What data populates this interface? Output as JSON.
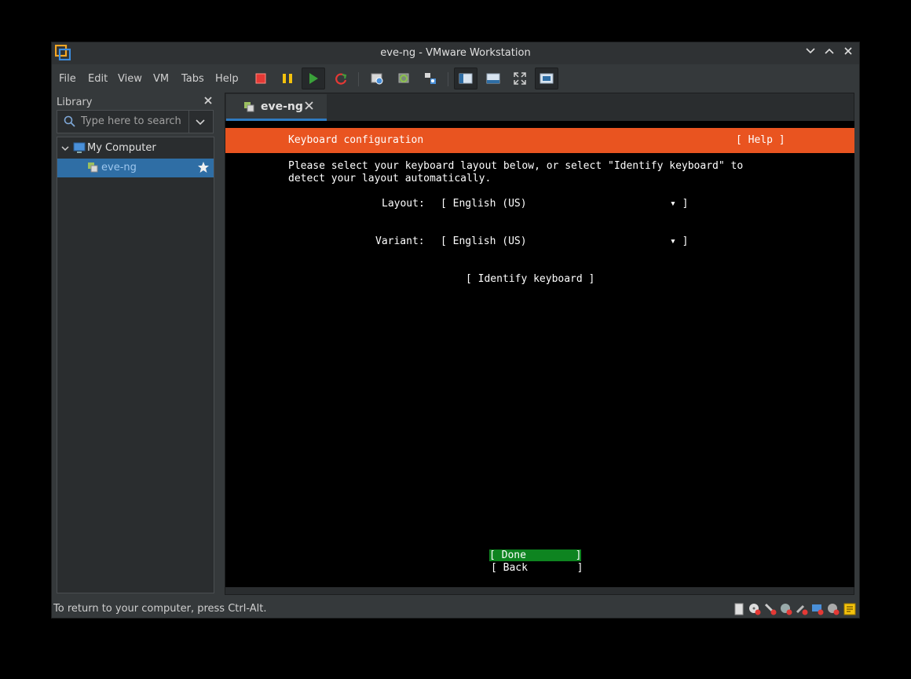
{
  "window": {
    "title": "eve-ng - VMware Workstation"
  },
  "menu": {
    "file": "File",
    "edit": "Edit",
    "view": "View",
    "vm": "VM",
    "tabs": "Tabs",
    "help": "Help"
  },
  "library": {
    "title": "Library",
    "search_placeholder": "Type here to search",
    "tree": [
      {
        "label": "My Computer"
      },
      {
        "label": "eve-ng"
      }
    ]
  },
  "tab": {
    "label": "eve-ng"
  },
  "console": {
    "header_title": "Keyboard configuration",
    "help_label": "[ Help ]",
    "instructions_line1": "Please select your keyboard layout below, or select \"Identify keyboard\" to",
    "instructions_line2": "detect your layout automatically.",
    "layout_label": "Layout:",
    "layout_value": "[ English (US)",
    "layout_end": "▾ ]",
    "variant_label": "Variant:",
    "variant_value": "[ English (US)",
    "variant_end": "▾ ]",
    "identify_label": "[ Identify keyboard ]",
    "done_label": "[ Done        ]",
    "back_label": "[ Back        ]"
  },
  "status": {
    "text": "To return to your computer, press Ctrl-Alt."
  },
  "colors": {
    "header": "#e95420",
    "done": "#0e8420",
    "selection": "#2f6ea5",
    "tab_underline": "#2f7ac0"
  }
}
